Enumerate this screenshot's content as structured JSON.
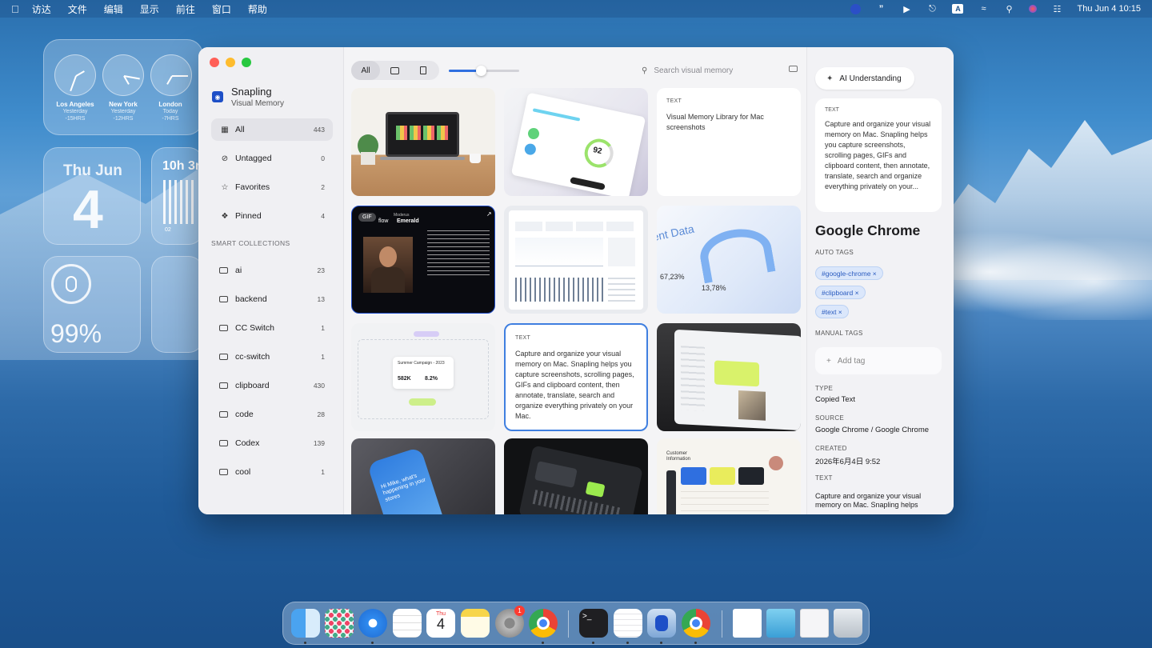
{
  "menubar": {
    "apple": "",
    "items": [
      "访达",
      "文件",
      "编辑",
      "显示",
      "前往",
      "窗口",
      "帮助"
    ],
    "datetime": "Thu Jun 4  10:15",
    "input_indicator": "A"
  },
  "widgets": {
    "clocks": [
      {
        "city": "Los Angeles",
        "day": "Yesterday",
        "offset": "-15HRS"
      },
      {
        "city": "New York",
        "day": "Yesterday",
        "offset": "-12HRS"
      },
      {
        "city": "London",
        "day": "Today",
        "offset": "-7HRS"
      }
    ],
    "calendar": {
      "weekday": "Thu Jun",
      "day": "4"
    },
    "timer_label": "10h 3r",
    "timer_sub": "02",
    "battery": "99%"
  },
  "sidebar": {
    "app_name": "Snapling",
    "app_sub": "Visual Memory",
    "nav": [
      {
        "label": "All",
        "count": "443",
        "icon": "grid-icon"
      },
      {
        "label": "Untagged",
        "count": "0",
        "icon": "tag-slash-icon"
      },
      {
        "label": "Favorites",
        "count": "2",
        "icon": "star-icon"
      },
      {
        "label": "Pinned",
        "count": "4",
        "icon": "pin-icon"
      }
    ],
    "smart_header": "SMART COLLECTIONS",
    "collections": [
      {
        "label": "ai",
        "count": "23"
      },
      {
        "label": "backend",
        "count": "13"
      },
      {
        "label": "CC Switch",
        "count": "1"
      },
      {
        "label": "cc-switch",
        "count": "1"
      },
      {
        "label": "clipboard",
        "count": "430"
      },
      {
        "label": "code",
        "count": "28"
      },
      {
        "label": "Codex",
        "count": "139"
      },
      {
        "label": "cool",
        "count": "1"
      }
    ]
  },
  "toolbar": {
    "filters": [
      "All"
    ],
    "zoom_level": 0.45,
    "search_placeholder": "Search visual memory"
  },
  "grid": {
    "text_card_1": {
      "type": "TEXT",
      "text": "Visual Memory Library for Mac screenshots"
    },
    "text_card_2": {
      "type": "TEXT",
      "text": "Capture and organize your visual memory on Mac. Snapling helps you capture screenshots, scrolling pages, GIFs and clipboard content, then annotate, translate, search and organize everything privately on your Mac."
    },
    "gif_badge": "GIF",
    "emerald_title": "Emerald",
    "emerald_brand": "flow",
    "emerald_pre": "Moderus",
    "campaign_title": "Summer Campaign - 2023",
    "campaign_v1": "582K",
    "campaign_v2": "8.2%",
    "analytics_title": "ent Data",
    "analytics_v1": "67,23%",
    "analytics_v2": "13,78%",
    "gauge_value": "92",
    "phone_text": "Hi Mike, what's happening in your stores",
    "customer_title": "Customer Information"
  },
  "detail": {
    "ai_button": "AI Understanding",
    "text_label": "TEXT",
    "text_preview": "Capture and organize your visual memory on Mac. Snapling helps you capture screenshots, scrolling pages, GIFs and clipboard content, then annotate, translate, search and organize everything privately on your...",
    "app_title": "Google Chrome",
    "auto_tags_label": "AUTO TAGS",
    "auto_tags": [
      "#google-chrome ×",
      "#clipboard ×",
      "#text ×"
    ],
    "manual_tags_label": "MANUAL TAGS",
    "add_tag_placeholder": "Add tag",
    "type_label": "TYPE",
    "type_value": "Copied Text",
    "source_label": "SOURCE",
    "source_value": "Google Chrome / Google Chrome",
    "created_label": "CREATED",
    "created_value": "2026年6月4日 9:52",
    "text_label2": "TEXT",
    "text_value": "Capture and organize your visual memory on Mac. Snapling helps"
  },
  "dock": {
    "calendar_weekday": "Thu",
    "calendar_day": "4",
    "settings_badge": "1"
  }
}
